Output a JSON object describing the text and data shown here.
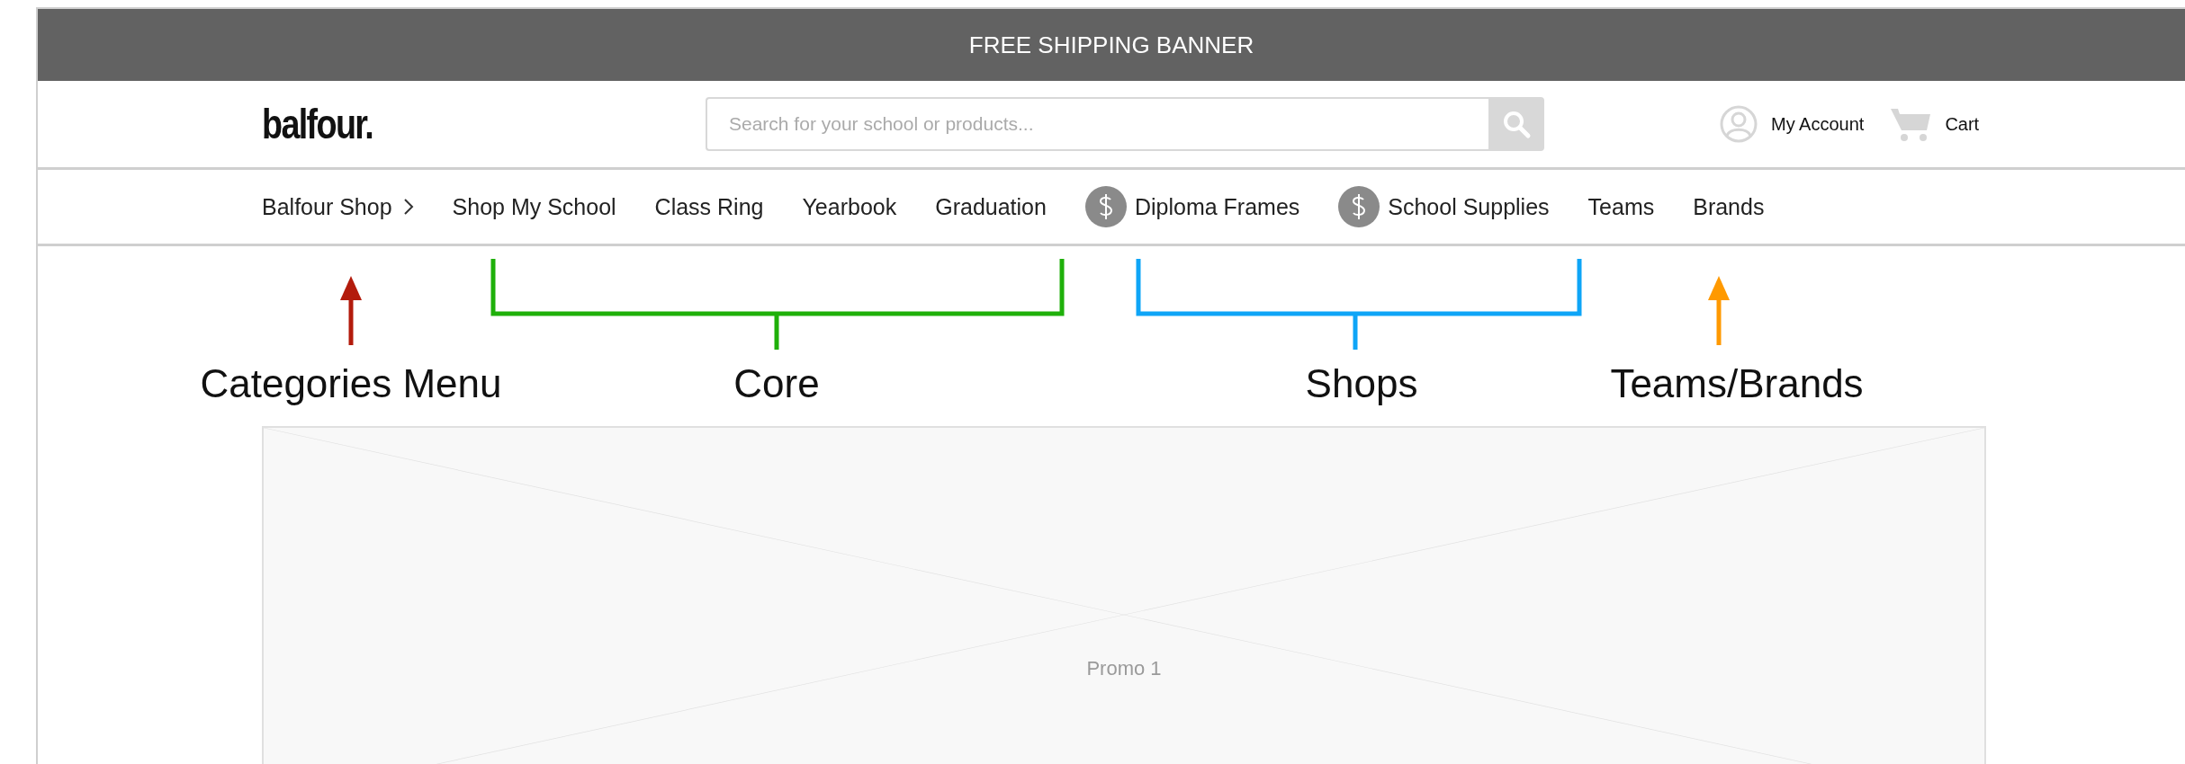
{
  "banner": {
    "text": "FREE SHIPPING BANNER"
  },
  "header": {
    "logo": "balfour.",
    "search": {
      "placeholder": "Search for your school or products..."
    },
    "account": "My Account",
    "cart": "Cart"
  },
  "nav": [
    {
      "label": "Balfour Shop",
      "kind": "menu"
    },
    {
      "label": "Shop My School",
      "kind": "link"
    },
    {
      "label": "Class Ring",
      "kind": "link"
    },
    {
      "label": "Yearbook",
      "kind": "link"
    },
    {
      "label": "Graduation",
      "kind": "link"
    },
    {
      "label": "Diploma Frames",
      "kind": "shop"
    },
    {
      "label": "School Supplies",
      "kind": "shop"
    },
    {
      "label": "Teams",
      "kind": "link"
    },
    {
      "label": "Brands",
      "kind": "link"
    }
  ],
  "annotations": [
    {
      "label": "Categories Menu",
      "kind": "arrow",
      "color": "#b31b0c"
    },
    {
      "label": "Core",
      "kind": "bracket",
      "color": "#1fb00a"
    },
    {
      "label": "Shops",
      "kind": "bracket",
      "color": "#0ea5f7"
    },
    {
      "label": "Teams/Brands",
      "kind": "arrow",
      "color": "#ff9900"
    }
  ],
  "promo": {
    "label": "Promo 1"
  }
}
